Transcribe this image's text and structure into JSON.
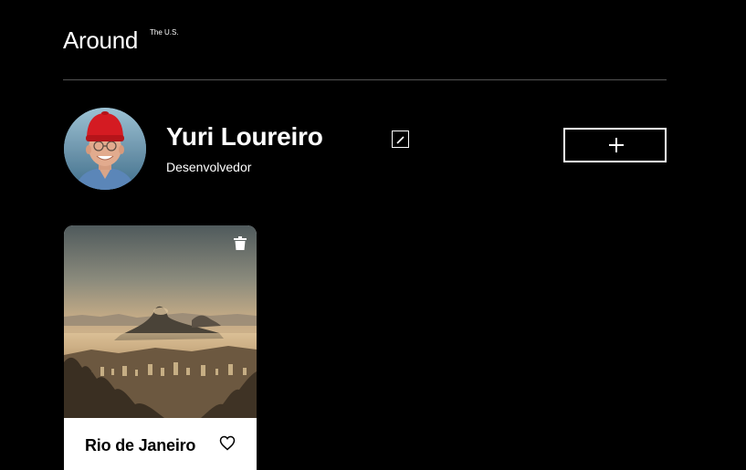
{
  "header": {
    "logo_text": "Around",
    "logo_superscript": "The U.S."
  },
  "profile": {
    "name": "Yuri Loureiro",
    "job": "Desenvolvedor",
    "avatar_icon": "avatar-photo",
    "edit_icon": "pencil-icon",
    "add_icon": "plus-icon"
  },
  "cards": [
    {
      "title": "Rio de Janeiro",
      "image": "sugarloaf-mountain-photo",
      "delete_icon": "trash-icon",
      "like_icon": "heart-outline-icon",
      "liked": false
    }
  ],
  "colors": {
    "background": "#000000",
    "text": "#ffffff",
    "card_background": "#ffffff",
    "card_text": "#000000",
    "divider": "#545454"
  }
}
